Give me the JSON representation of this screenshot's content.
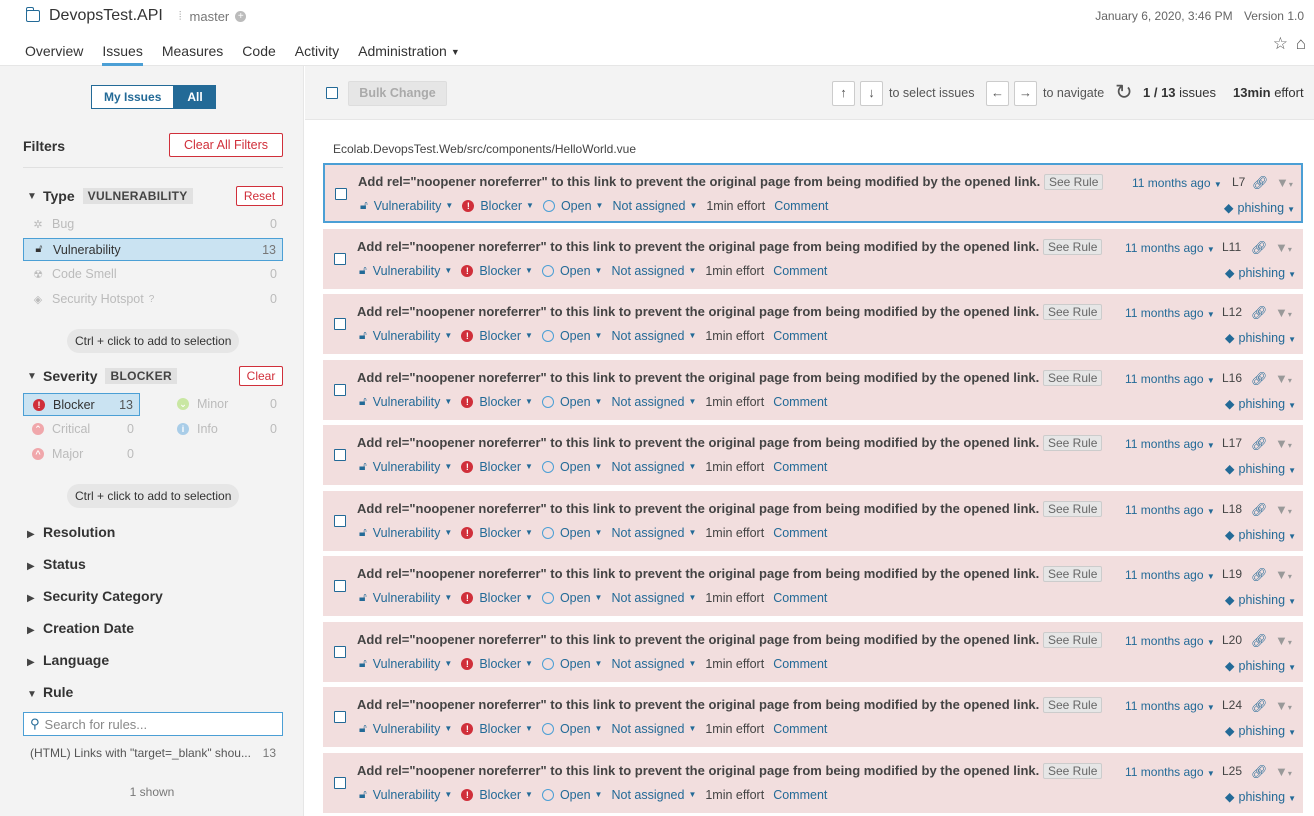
{
  "header": {
    "project_name": "DevopsTest.API",
    "branch": "master",
    "date": "January 6, 2020, 3:46 PM",
    "version": "Version 1.0",
    "tabs": [
      {
        "label": "Overview"
      },
      {
        "label": "Issues"
      },
      {
        "label": "Measures"
      },
      {
        "label": "Code"
      },
      {
        "label": "Activity"
      },
      {
        "label": "Administration"
      }
    ]
  },
  "sidebar": {
    "toggle": {
      "my_issues": "My Issues",
      "all": "All"
    },
    "filters_title": "Filters",
    "clear_all": "Clear All Filters",
    "type": {
      "title": "Type",
      "tag": "VULNERABILITY",
      "reset": "Reset",
      "items": [
        {
          "label": "Bug",
          "count": "0"
        },
        {
          "label": "Vulnerability",
          "count": "13"
        },
        {
          "label": "Code Smell",
          "count": "0"
        },
        {
          "label": "Security Hotspot",
          "count": "0"
        }
      ],
      "hint": "Ctrl + click to add to selection"
    },
    "severity": {
      "title": "Severity",
      "tag": "BLOCKER",
      "clear": "Clear",
      "items": [
        {
          "label": "Blocker",
          "count": "13"
        },
        {
          "label": "Minor",
          "count": "0"
        },
        {
          "label": "Critical",
          "count": "0"
        },
        {
          "label": "Info",
          "count": "0"
        },
        {
          "label": "Major",
          "count": "0"
        }
      ],
      "hint": "Ctrl + click to add to selection"
    },
    "collapsed": [
      "Resolution",
      "Status",
      "Security Category",
      "Creation Date",
      "Language"
    ],
    "rule": {
      "title": "Rule",
      "placeholder": "Search for rules...",
      "item_label": "(HTML) Links with \"target=_blank\" shou...",
      "item_count": "13",
      "shown": "1 shown"
    }
  },
  "toolbar": {
    "bulk_change": "Bulk Change",
    "select_hint": "to select issues",
    "navigate_hint": "to navigate",
    "count_current": "1 / 13",
    "count_label": "issues",
    "effort_value": "13min",
    "effort_label": "effort"
  },
  "file_path": "Ecolab.DevopsTest.Web/src/components/HelloWorld.vue",
  "issue_common": {
    "message": "Add rel=\"noopener noreferrer\" to this link to prevent the original page from being modified by the opened link.",
    "see_rule": "See Rule",
    "type": "Vulnerability",
    "severity": "Blocker",
    "status": "Open",
    "assignee": "Not assigned",
    "effort": "1min effort",
    "comment": "Comment",
    "when": "11 months ago",
    "tag": "phishing"
  },
  "issues": [
    {
      "line": "L7"
    },
    {
      "line": "L11"
    },
    {
      "line": "L12"
    },
    {
      "line": "L16"
    },
    {
      "line": "L17"
    },
    {
      "line": "L18"
    },
    {
      "line": "L19"
    },
    {
      "line": "L20"
    },
    {
      "line": "L24"
    },
    {
      "line": "L25"
    }
  ]
}
